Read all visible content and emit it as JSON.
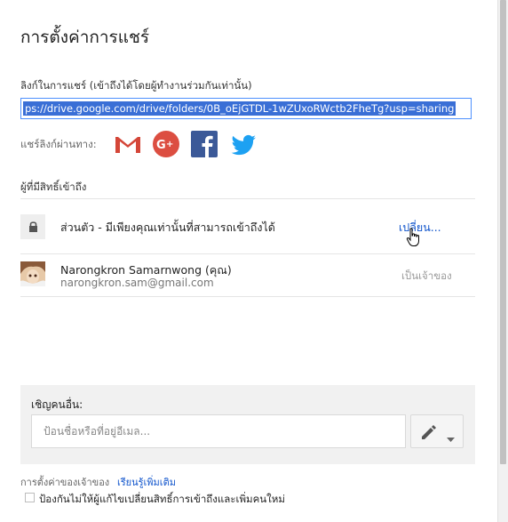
{
  "dialog": {
    "title": "การตั้งค่าการแชร์"
  },
  "link_sharing": {
    "label": "ลิงก์ในการแชร์ (เข้าถึงได้โดยผู้ทำงานร่วมกันเท่านั้น)",
    "url": "ps://drive.google.com/drive/folders/0B_oEjGTDL-1wZUxoRWctb2FheTg?usp=sharing"
  },
  "share_via": {
    "label": "แชร์ลิงก์ผ่านทาง:",
    "services": [
      "gmail-icon",
      "google-plus-icon",
      "facebook-icon",
      "twitter-icon"
    ]
  },
  "access": {
    "heading": "ผู้ที่มีสิทธิ์เข้าถึง",
    "visibility_text": "ส่วนตัว - มีเพียงคุณเท่านั้นที่สามารถเข้าถึงได้",
    "change_label": "เปลี่ยน...",
    "users": [
      {
        "name": "Narongkron Samarnwong (คุณ)",
        "email": "narongkron.sam@gmail.com",
        "role": "เป็นเจ้าของ"
      }
    ]
  },
  "invite": {
    "label": "เชิญคนอื่น:",
    "placeholder": "ป้อนชื่อหรือที่อยู่อีเมล..."
  },
  "footer": {
    "owner_settings": "การตั้งค่าของเจ้าของ",
    "learn_more": "เรียนรู้เพิ่มเติม",
    "prevent_label": "ป้องกันไม่ให้ผู้แก้ไขเปลี่ยนสิทธิ์การเข้าถึงและเพิ่มคนใหม่"
  },
  "colors": {
    "link": "#1155cc",
    "selection": "#3a6fd6",
    "gmail_red": "#d44638",
    "gplus_red": "#dc4e41",
    "facebook_blue": "#3b5998",
    "twitter_blue": "#1da1f2"
  }
}
